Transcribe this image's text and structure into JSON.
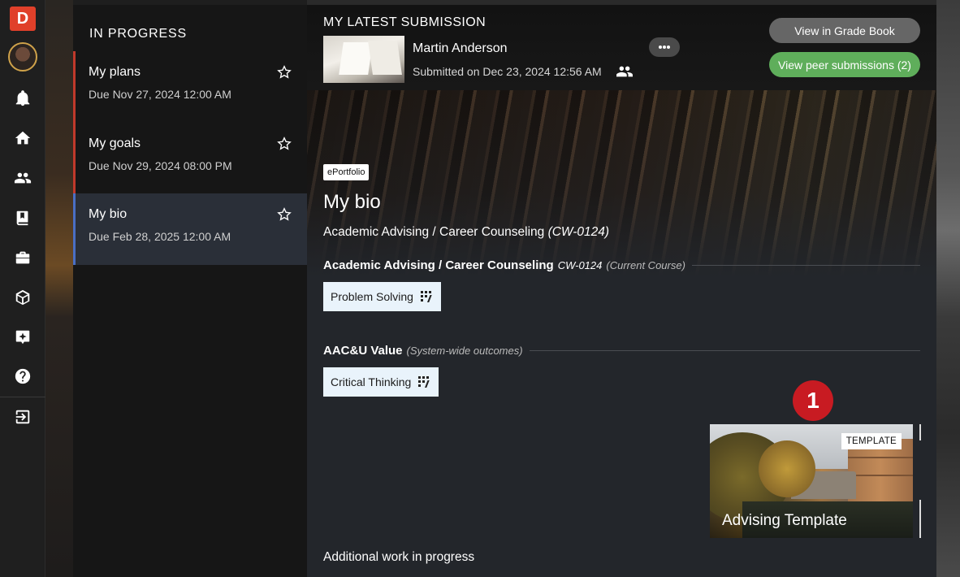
{
  "app": {
    "logo_letter": "D",
    "brand_color": "#e0402a"
  },
  "rail": {
    "icons": [
      "bell-icon",
      "home-icon",
      "people-icon",
      "book-icon",
      "briefcase-icon",
      "cube-icon",
      "sparkle-icon",
      "help-icon",
      "logout-icon"
    ]
  },
  "list": {
    "heading": "IN PROGRESS",
    "items": [
      {
        "title": "My plans",
        "due": "Due Nov 27, 2024 12:00 AM",
        "active": false
      },
      {
        "title": "My goals",
        "due": "Due Nov 29, 2024 08:00 PM",
        "active": false
      },
      {
        "title": "My bio",
        "due": "Due Feb 28, 2025 12:00 AM",
        "active": true
      }
    ]
  },
  "submission": {
    "label": "MY LATEST SUBMISSION",
    "author": "Martin Anderson",
    "submitted": "Submitted on Dec 23, 2024 12:56 AM",
    "grade_book_button": "View in Grade Book",
    "peer_button": "View peer submissions (2)"
  },
  "assignment": {
    "type_tag": "ePortfolio",
    "title": "My bio",
    "course_name": "Academic Advising / Career Counseling",
    "course_code": "(CW-0124)"
  },
  "outcomes": [
    {
      "name": "Academic Advising / Career Counseling",
      "code": "CW-0124",
      "note": "(Current Course)",
      "chip": "Problem Solving"
    },
    {
      "name": "AAC&U Value",
      "code": "",
      "note": "(System-wide outcomes)",
      "chip": "Critical Thinking"
    }
  ],
  "template": {
    "badge": "1",
    "tag": "TEMPLATE",
    "title": "Advising Template"
  },
  "footer": {
    "additional": "Additional work in progress"
  },
  "colors": {
    "accent_red": "#c0392b",
    "active_blue": "#4a6fc4",
    "peer_green": "#5fae5b",
    "badge_red": "#c81b22"
  }
}
